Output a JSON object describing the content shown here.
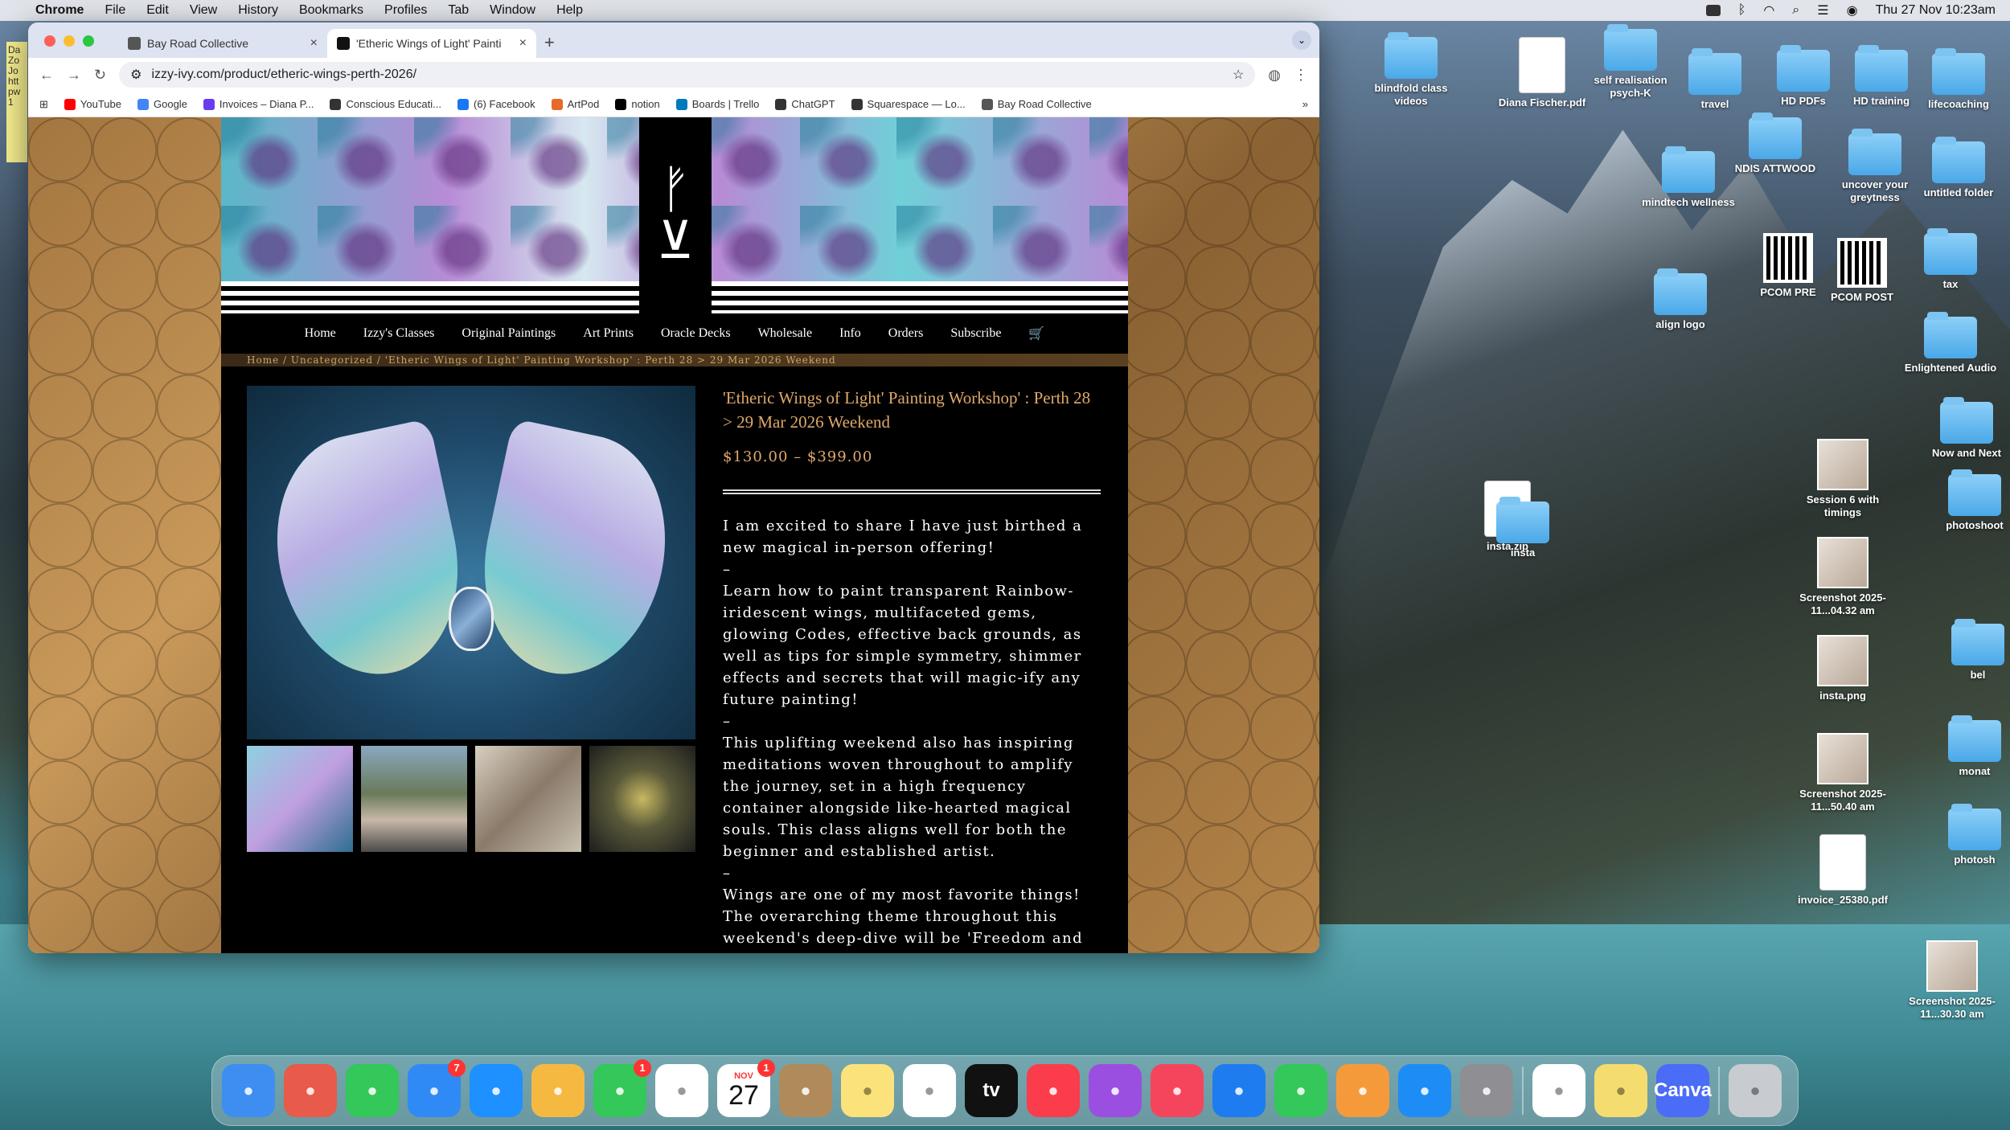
{
  "menubar": {
    "app": "Chrome",
    "items": [
      "File",
      "Edit",
      "View",
      "History",
      "Bookmarks",
      "Profiles",
      "Tab",
      "Window",
      "Help"
    ],
    "clock": "Thu 27 Nov  10:23am"
  },
  "sticky": {
    "text": "Da Zo Jo htt pw 1"
  },
  "browser": {
    "tabs": [
      {
        "title": "Bay Road Collective"
      },
      {
        "title": "'Etheric Wings of Light' Painti"
      }
    ],
    "url": "izzy-ivy.com/product/etheric-wings-perth-2026/",
    "bookmarks": [
      "YouTube",
      "Google",
      "Invoices – Diana P...",
      "Conscious Educati...",
      "(6) Facebook",
      "ArtPod",
      "notion",
      "Boards | Trello",
      "ChatGPT",
      "Squarespace — Lo...",
      "Bay Road Collective"
    ],
    "bookmark_colors": [
      "#ff0000",
      "#4285f4",
      "#6a3cf0",
      "#333333",
      "#1877f2",
      "#e86a2a",
      "#000000",
      "#0079bf",
      "#333333",
      "#333333",
      "#555555"
    ]
  },
  "site": {
    "nav": [
      "Home",
      "Izzy's Classes",
      "Original Paintings",
      "Art Prints",
      "Oracle Decks",
      "Wholesale",
      "Info",
      "Orders",
      "Subscribe"
    ],
    "breadcrumb": "Home  /  Uncategorized  /  'Etheric Wings of Light' Painting Workshop' : Perth 28 > 29 Mar 2026 Weekend",
    "product": {
      "title": "'Etheric Wings of Light' Painting Workshop' : Perth 28 > 29 Mar 2026 Weekend",
      "price": "$130.00 – $399.00",
      "description": [
        "I am excited to share I have just birthed a new magical in-person offering!",
        "–",
        "Learn  how to paint transparent Rainbow-iridescent wings, multifaceted gems, glowing Codes, effective back grounds, as well as tips for simple symmetry, shimmer effects and secrets that will magic-ify any future painting!",
        "–",
        "This uplifting weekend also has inspiring meditations woven throughout  to amplify the journey, set in a high frequency container alongside like-hearted magical souls.  This class aligns well for both the beginner and established artist.",
        "–",
        "Wings are one of my most favorite things! The overarching theme throughout this weekend's deep-dive will be 'Freedom and activating"
      ]
    }
  },
  "desktop": [
    {
      "label": "blindfold class videos",
      "kind": "folder"
    },
    {
      "label": "Diana Fischer.pdf",
      "kind": "doc"
    },
    {
      "label": "self realisation psych-K",
      "kind": "folder"
    },
    {
      "label": "travel",
      "kind": "folder"
    },
    {
      "label": "HD PDFs",
      "kind": "folder"
    },
    {
      "label": "HD training",
      "kind": "folder"
    },
    {
      "label": "lifecoaching",
      "kind": "folder"
    },
    {
      "label": "NDIS ATTWOOD",
      "kind": "folder"
    },
    {
      "label": "mindtech wellness",
      "kind": "folder"
    },
    {
      "label": "uncover your greytness",
      "kind": "folder"
    },
    {
      "label": "untitled folder",
      "kind": "folder"
    },
    {
      "label": "PCOM PRE",
      "kind": "qr"
    },
    {
      "label": "PCOM POST",
      "kind": "qr"
    },
    {
      "label": "tax",
      "kind": "folder"
    },
    {
      "label": "align logo",
      "kind": "folder"
    },
    {
      "label": "Enlightened Audio",
      "kind": "folder"
    },
    {
      "label": "insta.zip",
      "kind": "doc"
    },
    {
      "label": "insta",
      "kind": "folder"
    },
    {
      "label": "Session 6 with timings",
      "kind": "image"
    },
    {
      "label": "Now and Next",
      "kind": "folder"
    },
    {
      "label": "photoshoot",
      "kind": "folder"
    },
    {
      "label": "Screenshot 2025-11...04.32 am",
      "kind": "image"
    },
    {
      "label": "insta.png",
      "kind": "image"
    },
    {
      "label": "bel",
      "kind": "folder"
    },
    {
      "label": "Screenshot 2025-11...50.40 am",
      "kind": "image"
    },
    {
      "label": "monat",
      "kind": "folder"
    },
    {
      "label": "invoice_25380.pdf",
      "kind": "doc"
    },
    {
      "label": "photosh",
      "kind": "folder"
    },
    {
      "label": "Screenshot 2025-11...30.30 am",
      "kind": "image"
    }
  ],
  "dock": [
    {
      "name": "Finder",
      "color": "#3d8ef0"
    },
    {
      "name": "Launchpad",
      "color": "#e85a4a"
    },
    {
      "name": "Messages",
      "color": "#34c759"
    },
    {
      "name": "Mail",
      "color": "#2f8af5",
      "badge": "7"
    },
    {
      "name": "Safari",
      "color": "#1e90ff"
    },
    {
      "name": "Photos",
      "color": "#f5b942"
    },
    {
      "name": "FaceTime",
      "color": "#34c759",
      "badge": "1"
    },
    {
      "name": "Freeform",
      "color": "#ffffff"
    },
    {
      "name": "Calendar",
      "month": "NOV",
      "day": "27",
      "badge": "1"
    },
    {
      "name": "Contacts",
      "color": "#b08a5a"
    },
    {
      "name": "Notes",
      "color": "#fbe27a"
    },
    {
      "name": "Reminders",
      "color": "#ffffff"
    },
    {
      "name": "TV",
      "color": "#111111",
      "text": "tv"
    },
    {
      "name": "Music",
      "color": "#fa3c4c"
    },
    {
      "name": "Podcasts",
      "color": "#9b4fe0"
    },
    {
      "name": "News",
      "color": "#f5455c"
    },
    {
      "name": "Keynote",
      "color": "#1e7cf0"
    },
    {
      "name": "Numbers",
      "color": "#34c759"
    },
    {
      "name": "Pages",
      "color": "#f59a3b"
    },
    {
      "name": "App Store",
      "color": "#1e8cf5"
    },
    {
      "name": "System Settings",
      "color": "#8e8e93"
    },
    {
      "name": "Chrome",
      "color": "#ffffff"
    },
    {
      "name": "Stickies",
      "color": "#f4dc6e"
    },
    {
      "name": "Canva",
      "color": "#4a6cf7",
      "text": "Canva"
    },
    {
      "name": "Trash",
      "color": "#c8ccd0"
    }
  ]
}
